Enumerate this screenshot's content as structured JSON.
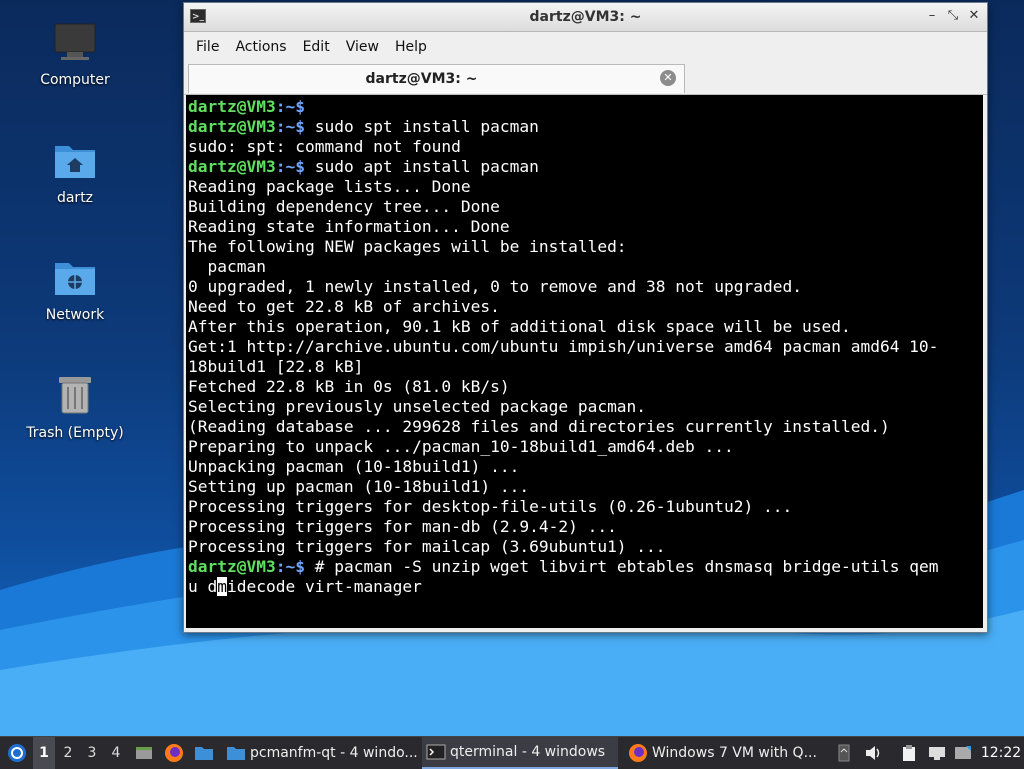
{
  "desktop": {
    "icons": [
      {
        "label": "Computer"
      },
      {
        "label": "dartz"
      },
      {
        "label": "Network"
      },
      {
        "label": "Trash (Empty)"
      }
    ]
  },
  "window": {
    "title": "dartz@VM3: ~",
    "controls": {
      "minimize": "–",
      "restore": "⤡",
      "close": "✕"
    },
    "menu": [
      "File",
      "Actions",
      "Edit",
      "View",
      "Help"
    ],
    "tab": {
      "label": "dartz@VM3: ~",
      "close": "✕"
    }
  },
  "terminal": {
    "prompt_user": "dartz@VM3",
    "prompt_path": ":~$",
    "lines": [
      {
        "type": "prompt",
        "cmd": ""
      },
      {
        "type": "prompt",
        "cmd": " sudo spt install pacman"
      },
      {
        "type": "out",
        "text": "sudo: spt: command not found"
      },
      {
        "type": "prompt",
        "cmd": " sudo apt install pacman"
      },
      {
        "type": "out",
        "text": "Reading package lists... Done"
      },
      {
        "type": "out",
        "text": "Building dependency tree... Done"
      },
      {
        "type": "out",
        "text": "Reading state information... Done"
      },
      {
        "type": "out",
        "text": "The following NEW packages will be installed:"
      },
      {
        "type": "out",
        "text": "  pacman"
      },
      {
        "type": "out",
        "text": "0 upgraded, 1 newly installed, 0 to remove and 38 not upgraded."
      },
      {
        "type": "out",
        "text": "Need to get 22.8 kB of archives."
      },
      {
        "type": "out",
        "text": "After this operation, 90.1 kB of additional disk space will be used."
      },
      {
        "type": "out",
        "text": "Get:1 http://archive.ubuntu.com/ubuntu impish/universe amd64 pacman amd64 10-"
      },
      {
        "type": "out",
        "text": "18build1 [22.8 kB]"
      },
      {
        "type": "out",
        "text": "Fetched 22.8 kB in 0s (81.0 kB/s)"
      },
      {
        "type": "out",
        "text": "Selecting previously unselected package pacman."
      },
      {
        "type": "out",
        "text": "(Reading database ... 299628 files and directories currently installed.)"
      },
      {
        "type": "out",
        "text": "Preparing to unpack .../pacman_10-18build1_amd64.deb ..."
      },
      {
        "type": "out",
        "text": "Unpacking pacman (10-18build1) ..."
      },
      {
        "type": "out",
        "text": "Setting up pacman (10-18build1) ..."
      },
      {
        "type": "out",
        "text": "Processing triggers for desktop-file-utils (0.26-1ubuntu2) ..."
      },
      {
        "type": "out",
        "text": "Processing triggers for man-db (2.9.4-2) ..."
      },
      {
        "type": "out",
        "text": "Processing triggers for mailcap (3.69ubuntu1) ..."
      },
      {
        "type": "prompt",
        "cmd": " # pacman -S unzip wget libvirt ebtables dnsmasq bridge-utils qem"
      }
    ],
    "last_line_before": "u d",
    "last_line_cursor": "m",
    "last_line_after": "idecode virt-manager"
  },
  "taskbar": {
    "workspaces": [
      "1",
      "2",
      "3",
      "4"
    ],
    "active_workspace": "1",
    "tasks": [
      {
        "label": "pcmanfm-qt - 4 windo...",
        "icon": "folder-icon"
      },
      {
        "label": "qterminal - 4 windows",
        "icon": "terminal-icon"
      },
      {
        "label": "Windows 7 VM with Q...",
        "icon": "firefox-icon"
      }
    ],
    "clock": "12:22"
  }
}
